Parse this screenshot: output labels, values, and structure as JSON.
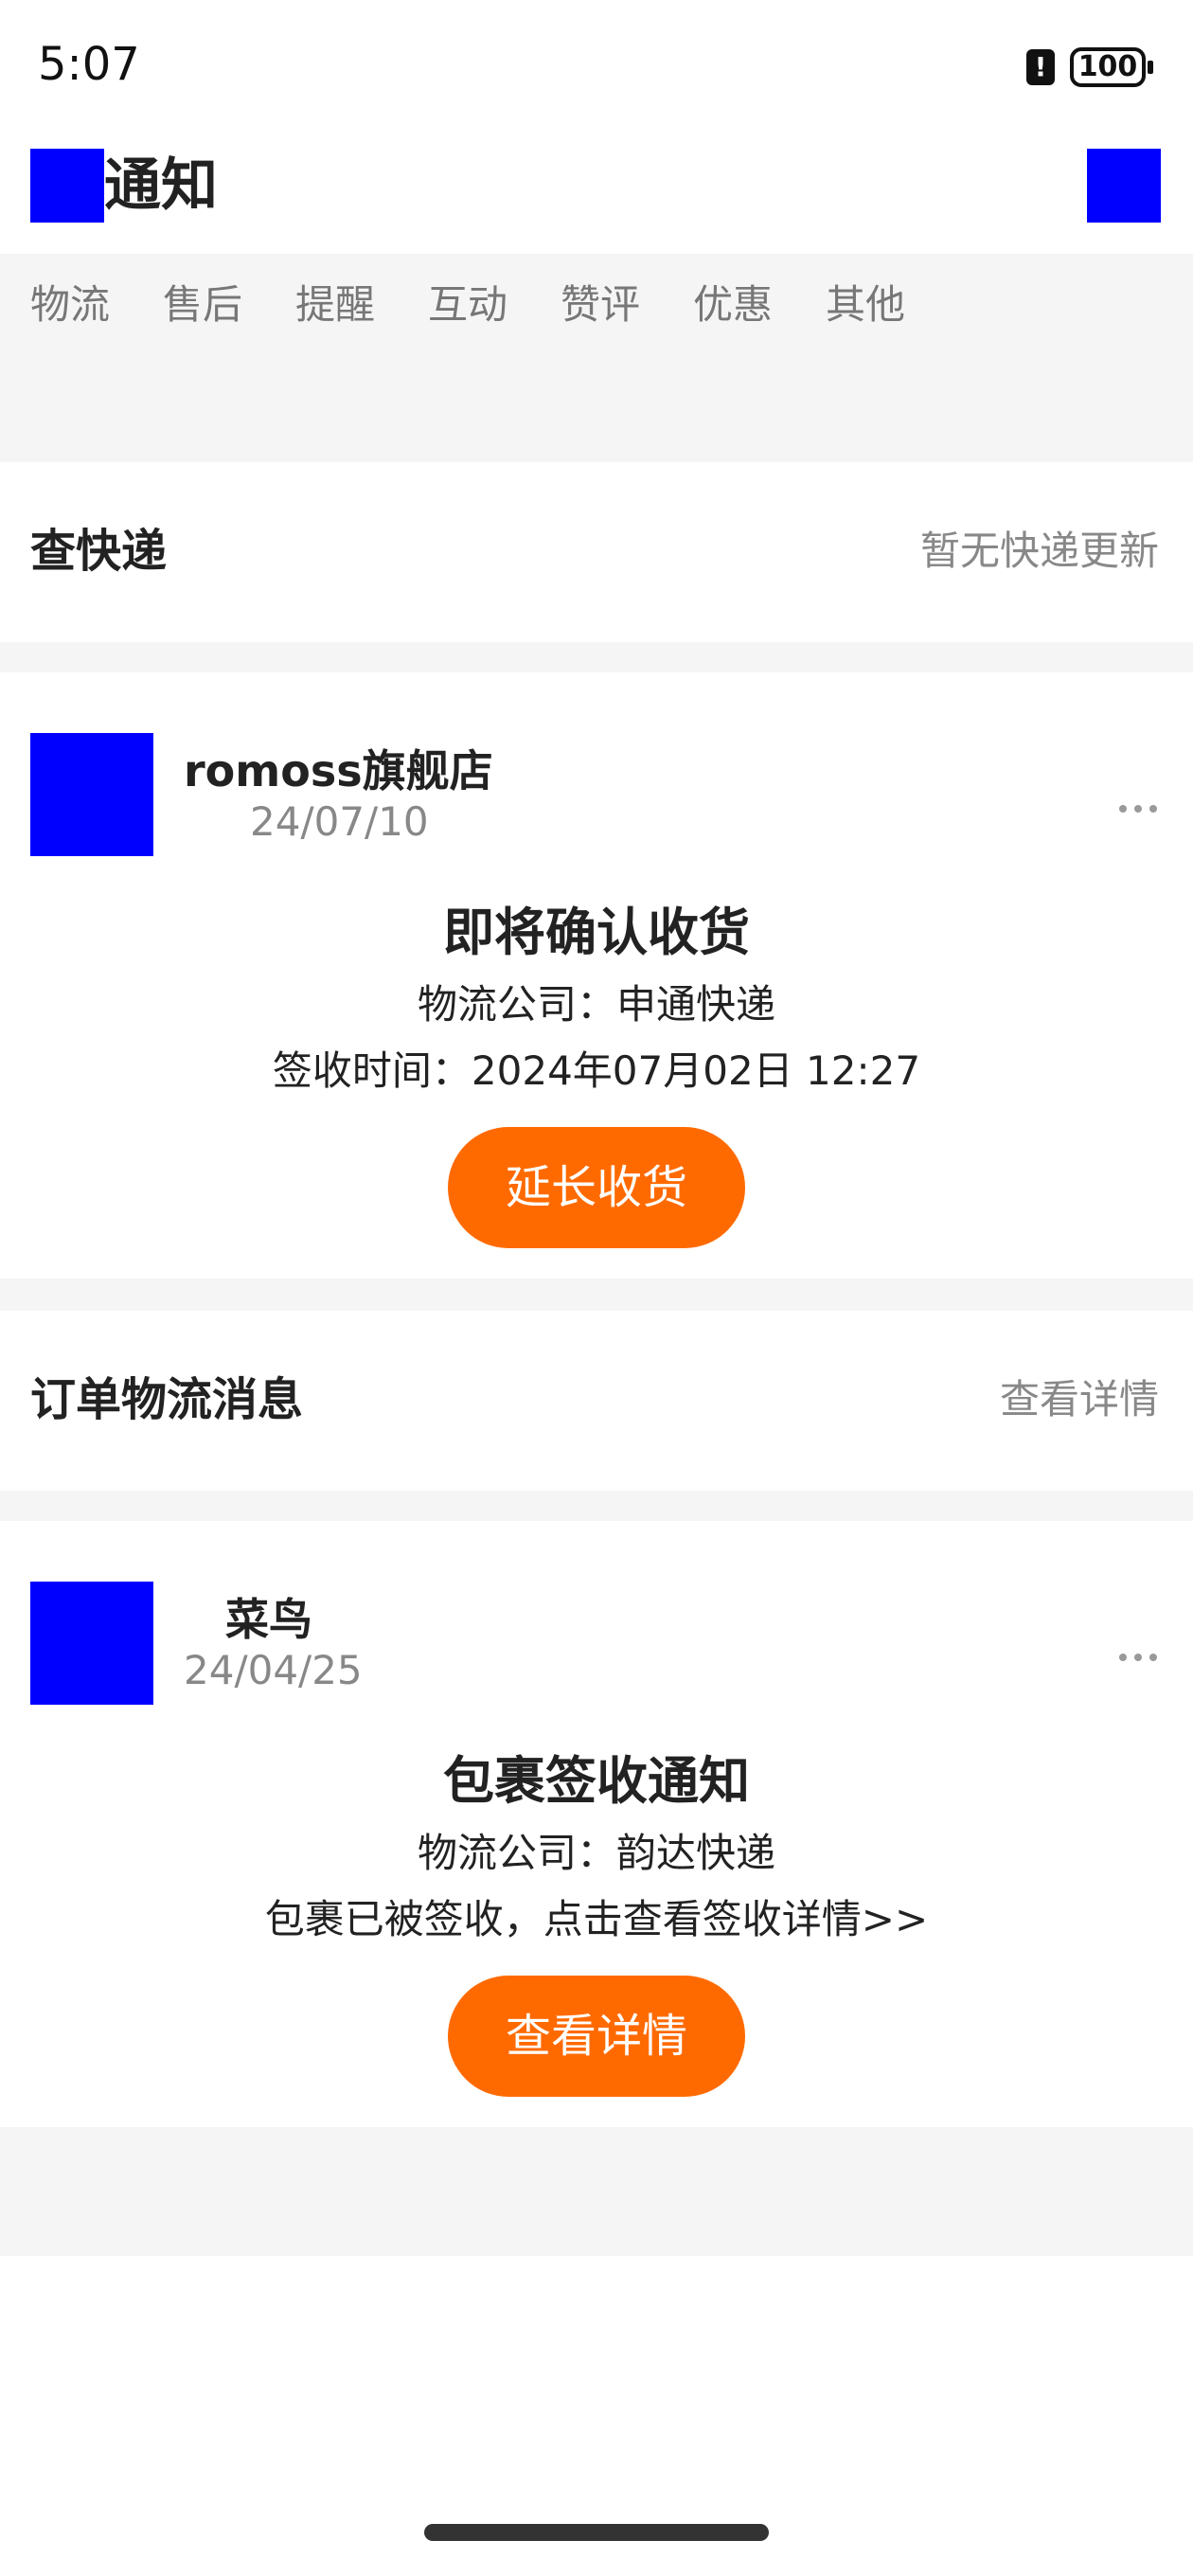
{
  "status_bar": {
    "time": "5:07",
    "battery": "100"
  },
  "header": {
    "title": "通知"
  },
  "tabs": [
    "物流",
    "售后",
    "提醒",
    "互动",
    "赞评",
    "优惠",
    "其他"
  ],
  "express_section": {
    "title": "查快递",
    "status": "暂无快递更新"
  },
  "card1": {
    "sender": "romoss旗舰店",
    "date": "24/07/10",
    "headline": "即将确认收货",
    "line1": "物流公司：申通快递",
    "line2": "签收时间：2024年07月02日 12:27",
    "button": "延长收货"
  },
  "order_section": {
    "title": "订单物流消息",
    "link": "查看详情"
  },
  "card2": {
    "sender": "菜鸟",
    "date": "24/04/25",
    "headline": "包裹签收通知",
    "line1": "物流公司：韵达快递",
    "line2": "包裹已被签收，点击查看签收详情>>",
    "button": "查看详情"
  },
  "colors": {
    "accent": "#ff6a00",
    "icon_placeholder": "#0000ff",
    "background_gray": "#f5f5f5"
  }
}
